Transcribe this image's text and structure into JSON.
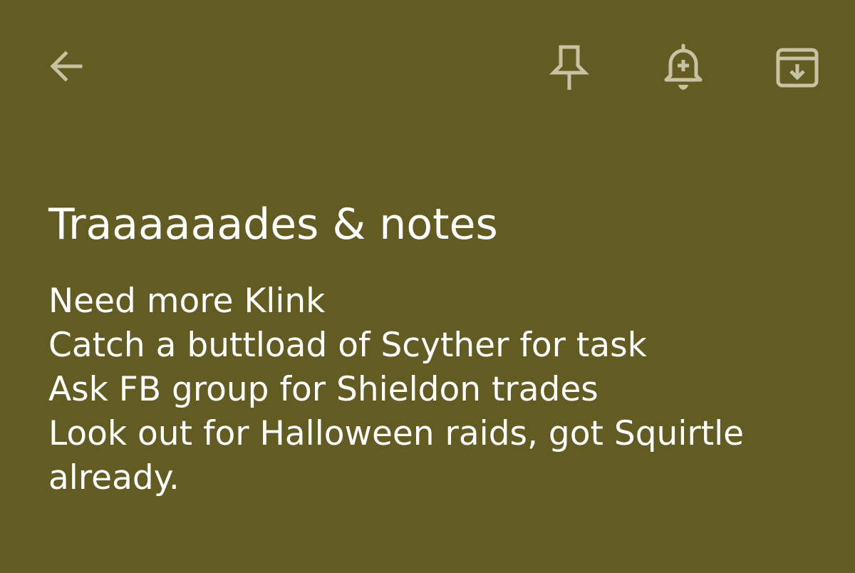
{
  "toolbar": {
    "icons": {
      "back": "arrow-left",
      "pin": "pin",
      "reminder": "bell-plus",
      "archive": "archive"
    },
    "icon_color": "#c7c2a3"
  },
  "note": {
    "title": "Traaaaaades & notes",
    "lines": [
      "Need more Klink",
      "Catch a buttload of Scyther for task",
      "Ask FB group for Shieldon trades",
      "Look out for Halloween raids, got Squirtle already."
    ],
    "background_color": "#635c22",
    "text_color": "#ffffff"
  }
}
